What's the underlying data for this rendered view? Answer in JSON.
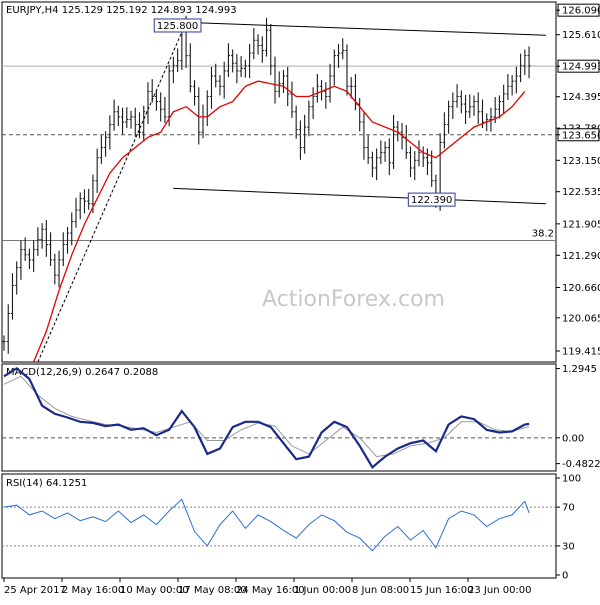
{
  "chart_data": [
    {
      "type": "candlestick",
      "panel": "price",
      "title": "EURJPY,H4  125.129 125.192 124.893 124.993",
      "watermark": "ActionForex.com",
      "ylim": [
        119.2,
        126.25
      ],
      "y_ticks": [
        "126.090",
        "125.610",
        "124.993",
        "124.395",
        "123.780",
        "123.650",
        "123.150",
        "122.535",
        "121.905",
        "121.290",
        "120.660",
        "120.065",
        "119.415"
      ],
      "y_tick_values": [
        126.09,
        125.61,
        124.993,
        124.395,
        123.78,
        123.65,
        123.15,
        122.535,
        121.905,
        121.29,
        120.66,
        120.065,
        119.415
      ],
      "highlighted_ticks": {
        "126.090": true,
        "124.993": true,
        "123.650": true
      },
      "close_path": [
        [
          0,
          119.6
        ],
        [
          2,
          120.7
        ],
        [
          4,
          121.4
        ],
        [
          6,
          121.2
        ],
        [
          9,
          121.8
        ],
        [
          12,
          120.9
        ],
        [
          14,
          121.5
        ],
        [
          18,
          122.4
        ],
        [
          20,
          122.3
        ],
        [
          22,
          123.2
        ],
        [
          24,
          123.6
        ],
        [
          26,
          124.1
        ],
        [
          28,
          123.9
        ],
        [
          30,
          124.0
        ],
        [
          32,
          123.7
        ],
        [
          34,
          124.5
        ],
        [
          36,
          124.3
        ],
        [
          38,
          124.0
        ],
        [
          39,
          124.9
        ],
        [
          41,
          125.1
        ],
        [
          42,
          125.8
        ],
        [
          44,
          124.6
        ],
        [
          45,
          124.4
        ],
        [
          46,
          123.7
        ],
        [
          47,
          124.0
        ],
        [
          49,
          124.8
        ],
        [
          51,
          124.6
        ],
        [
          53,
          125.2
        ],
        [
          55,
          124.9
        ],
        [
          57,
          125.0
        ],
        [
          59,
          125.5
        ],
        [
          61,
          125.3
        ],
        [
          62,
          125.7
        ],
        [
          63,
          125.0
        ],
        [
          64,
          124.5
        ],
        [
          66,
          124.8
        ],
        [
          68,
          124.1
        ],
        [
          70,
          123.4
        ],
        [
          72,
          124.2
        ],
        [
          74,
          124.6
        ],
        [
          76,
          124.4
        ],
        [
          78,
          125.2
        ],
        [
          80,
          125.3
        ],
        [
          81,
          124.6
        ],
        [
          82,
          124.6
        ],
        [
          84,
          123.9
        ],
        [
          85,
          123.4
        ],
        [
          87,
          123.0
        ],
        [
          88,
          123.2
        ],
        [
          90,
          123.4
        ],
        [
          91,
          123.1
        ],
        [
          92,
          123.8
        ],
        [
          94,
          123.6
        ],
        [
          96,
          123.0
        ],
        [
          98,
          123.3
        ],
        [
          100,
          123.1
        ],
        [
          102,
          122.4
        ],
        [
          103,
          123.5
        ],
        [
          105,
          124.2
        ],
        [
          107,
          124.4
        ],
        [
          109,
          124.1
        ],
        [
          111,
          124.3
        ],
        [
          113,
          123.9
        ],
        [
          115,
          124.0
        ],
        [
          117,
          124.3
        ],
        [
          119,
          124.6
        ],
        [
          121,
          124.8
        ],
        [
          123,
          125.2
        ],
        [
          124,
          125.0
        ]
      ],
      "ma_path": [
        [
          7,
          119.2
        ],
        [
          10,
          119.8
        ],
        [
          13,
          120.6
        ],
        [
          16,
          121.3
        ],
        [
          19,
          121.9
        ],
        [
          22,
          122.4
        ],
        [
          25,
          122.9
        ],
        [
          28,
          123.2
        ],
        [
          31,
          123.4
        ],
        [
          34,
          123.6
        ],
        [
          37,
          123.7
        ],
        [
          40,
          124.1
        ],
        [
          43,
          124.2
        ],
        [
          46,
          124.0
        ],
        [
          48,
          124.0
        ],
        [
          51,
          124.2
        ],
        [
          54,
          124.3
        ],
        [
          57,
          124.6
        ],
        [
          60,
          124.7
        ],
        [
          63,
          124.65
        ],
        [
          66,
          124.6
        ],
        [
          69,
          124.4
        ],
        [
          72,
          124.4
        ],
        [
          75,
          124.5
        ],
        [
          78,
          124.6
        ],
        [
          81,
          124.5
        ],
        [
          84,
          124.2
        ],
        [
          87,
          123.9
        ],
        [
          90,
          123.8
        ],
        [
          93,
          123.7
        ],
        [
          96,
          123.5
        ],
        [
          99,
          123.3
        ],
        [
          102,
          123.2
        ],
        [
          105,
          123.4
        ],
        [
          108,
          123.6
        ],
        [
          111,
          123.8
        ],
        [
          114,
          123.9
        ],
        [
          117,
          124.0
        ],
        [
          120,
          124.2
        ],
        [
          123,
          124.5
        ]
      ],
      "ma_color": "#e60000",
      "hlines": [
        {
          "y": 124.993,
          "style": "solid",
          "color": "#aaaaaa"
        },
        {
          "y": 123.65,
          "style": "dashed",
          "color": "#555555"
        },
        {
          "y": 121.58,
          "style": "solid",
          "color": "#777777"
        }
      ],
      "trendlines": [
        {
          "from": [
            43,
            125.85
          ],
          "to": [
            128,
            125.6
          ],
          "style": "solid"
        },
        {
          "from": [
            40,
            122.6
          ],
          "to": [
            128,
            122.3
          ],
          "style": "solid"
        },
        {
          "from": [
            8,
            119.2
          ],
          "to": [
            43,
            125.85
          ],
          "style": "dashed"
        }
      ],
      "annotations": [
        {
          "text": "125.800",
          "x": 41,
          "y": 125.8,
          "boxed": true
        },
        {
          "text": "122.390",
          "x": 101,
          "y": 122.39,
          "boxed": true
        },
        {
          "text": "38.2",
          "x": 127,
          "y": 121.6,
          "boxed": false
        }
      ],
      "x_ticks": [
        "25 Apr 2017",
        "2 May 16:00",
        "10 May 00:00",
        "17 May 08:00",
        "24 May 16:00",
        "1 Jun 00:00",
        "8 Jun 08:00",
        "15 Jun 16:00",
        "23 Jun 00:00"
      ]
    },
    {
      "type": "line",
      "panel": "macd",
      "title": "MACD(12,26,9)  0.2647  0.2088",
      "ylim": [
        -0.62,
        1.38
      ],
      "y_ticks": [
        "1.2945",
        "0.00",
        "-0.4822"
      ],
      "y_tick_values": [
        1.2945,
        0.0,
        -0.4822
      ],
      "zero_line": true,
      "series": [
        {
          "name": "MACD",
          "color": "#1a2a8a",
          "values": [
            [
              0,
              1.15
            ],
            [
              3,
              1.3
            ],
            [
              6,
              1.1
            ],
            [
              9,
              0.6
            ],
            [
              12,
              0.45
            ],
            [
              15,
              0.38
            ],
            [
              18,
              0.3
            ],
            [
              21,
              0.28
            ],
            [
              24,
              0.22
            ],
            [
              27,
              0.25
            ],
            [
              30,
              0.15
            ],
            [
              33,
              0.18
            ],
            [
              36,
              0.05
            ],
            [
              39,
              0.15
            ],
            [
              42,
              0.5
            ],
            [
              45,
              0.2
            ],
            [
              48,
              -0.3
            ],
            [
              51,
              -0.2
            ],
            [
              54,
              0.2
            ],
            [
              57,
              0.3
            ],
            [
              60,
              0.3
            ],
            [
              63,
              0.2
            ],
            [
              66,
              -0.1
            ],
            [
              69,
              -0.4
            ],
            [
              72,
              -0.35
            ],
            [
              75,
              0.1
            ],
            [
              78,
              0.3
            ],
            [
              81,
              0.2
            ],
            [
              84,
              -0.15
            ],
            [
              87,
              -0.55
            ],
            [
              90,
              -0.35
            ],
            [
              93,
              -0.2
            ],
            [
              96,
              -0.1
            ],
            [
              99,
              -0.05
            ],
            [
              102,
              -0.25
            ],
            [
              105,
              0.25
            ],
            [
              108,
              0.4
            ],
            [
              111,
              0.35
            ],
            [
              114,
              0.15
            ],
            [
              117,
              0.1
            ],
            [
              120,
              0.12
            ],
            [
              123,
              0.25
            ],
            [
              124,
              0.26
            ]
          ]
        },
        {
          "name": "Signal",
          "color": "#999999",
          "values": [
            [
              0,
              1.0
            ],
            [
              4,
              1.15
            ],
            [
              8,
              0.8
            ],
            [
              12,
              0.55
            ],
            [
              16,
              0.4
            ],
            [
              20,
              0.32
            ],
            [
              24,
              0.25
            ],
            [
              28,
              0.22
            ],
            [
              32,
              0.16
            ],
            [
              36,
              0.1
            ],
            [
              40,
              0.2
            ],
            [
              44,
              0.3
            ],
            [
              48,
              -0.05
            ],
            [
              52,
              -0.05
            ],
            [
              56,
              0.15
            ],
            [
              60,
              0.28
            ],
            [
              64,
              0.22
            ],
            [
              68,
              -0.15
            ],
            [
              72,
              -0.3
            ],
            [
              76,
              -0.05
            ],
            [
              80,
              0.2
            ],
            [
              84,
              0.0
            ],
            [
              88,
              -0.35
            ],
            [
              92,
              -0.3
            ],
            [
              96,
              -0.15
            ],
            [
              100,
              -0.1
            ],
            [
              104,
              0.0
            ],
            [
              108,
              0.3
            ],
            [
              112,
              0.3
            ],
            [
              116,
              0.15
            ],
            [
              120,
              0.12
            ],
            [
              124,
              0.21
            ]
          ]
        }
      ]
    },
    {
      "type": "line",
      "panel": "rsi",
      "title": "RSI(14)  64.1251",
      "ylim": [
        0,
        100
      ],
      "y_ticks": [
        "100",
        "70",
        "30",
        "0"
      ],
      "y_tick_values": [
        100,
        70,
        30,
        0
      ],
      "dashed_levels": [
        70,
        30
      ],
      "series": [
        {
          "name": "RSI",
          "color": "#2a6fd6",
          "values": [
            [
              0,
              70
            ],
            [
              3,
              72
            ],
            [
              6,
              62
            ],
            [
              9,
              66
            ],
            [
              12,
              58
            ],
            [
              15,
              64
            ],
            [
              18,
              56
            ],
            [
              21,
              60
            ],
            [
              24,
              55
            ],
            [
              27,
              66
            ],
            [
              30,
              54
            ],
            [
              33,
              62
            ],
            [
              36,
              52
            ],
            [
              39,
              66
            ],
            [
              42,
              78
            ],
            [
              45,
              45
            ],
            [
              48,
              30
            ],
            [
              51,
              52
            ],
            [
              54,
              66
            ],
            [
              57,
              48
            ],
            [
              60,
              62
            ],
            [
              63,
              55
            ],
            [
              66,
              46
            ],
            [
              69,
              38
            ],
            [
              72,
              52
            ],
            [
              75,
              62
            ],
            [
              78,
              56
            ],
            [
              81,
              44
            ],
            [
              84,
              38
            ],
            [
              87,
              25
            ],
            [
              90,
              40
            ],
            [
              93,
              50
            ],
            [
              96,
              36
            ],
            [
              99,
              46
            ],
            [
              102,
              28
            ],
            [
              105,
              58
            ],
            [
              108,
              66
            ],
            [
              111,
              62
            ],
            [
              114,
              50
            ],
            [
              117,
              58
            ],
            [
              120,
              62
            ],
            [
              123,
              76
            ],
            [
              124,
              64
            ]
          ]
        }
      ]
    }
  ]
}
